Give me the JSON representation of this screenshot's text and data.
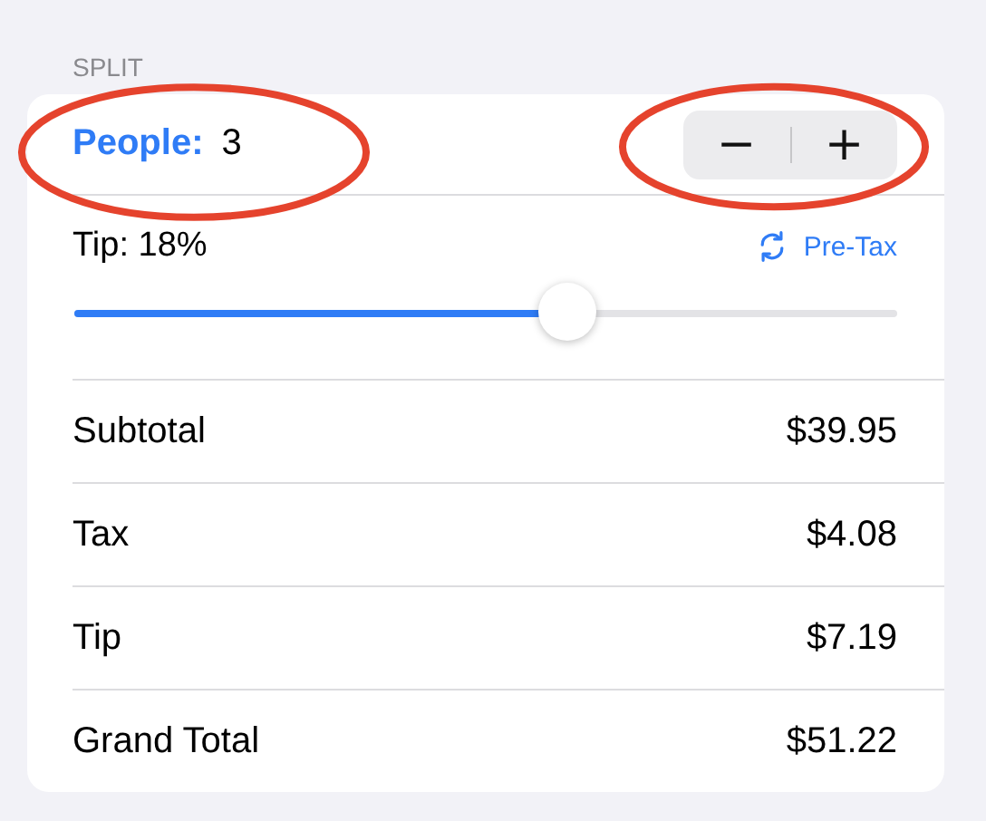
{
  "section": {
    "title": "SPLIT"
  },
  "people": {
    "label": "People:",
    "value": "3",
    "highlighted": true
  },
  "stepper": {
    "minus": "−",
    "plus": "+",
    "highlighted": true
  },
  "tip": {
    "label": "Tip: 18%",
    "mode": "Pre-Tax",
    "level": 0.6
  },
  "totals": [
    {
      "label": "Subtotal",
      "value": "$39.95"
    },
    {
      "label": "Tax",
      "value": "$4.08"
    },
    {
      "label": "Tip",
      "value": "$7.19"
    },
    {
      "label": "Grand Total",
      "value": "$51.22"
    }
  ]
}
